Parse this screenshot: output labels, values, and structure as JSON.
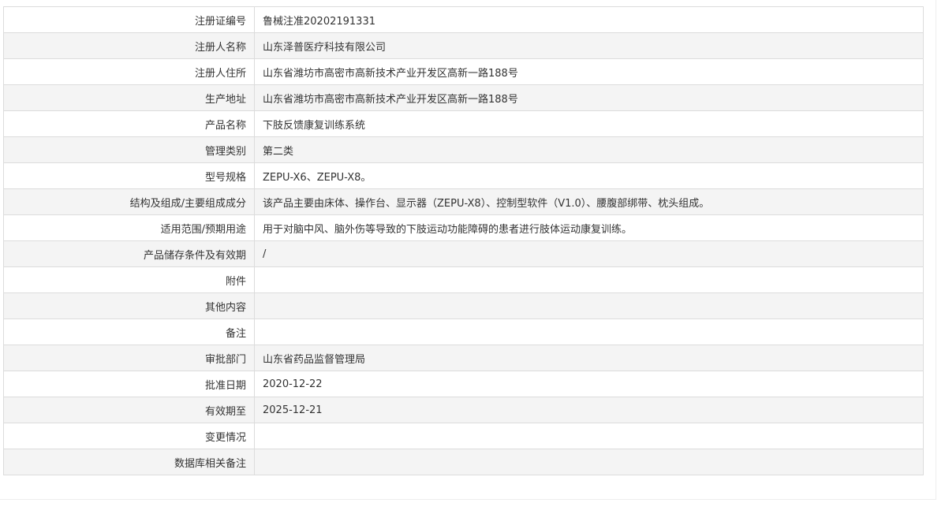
{
  "rows": [
    {
      "label": "注册证编号",
      "value": "鲁械注准20202191331"
    },
    {
      "label": "注册人名称",
      "value": "山东泽普医疗科技有限公司"
    },
    {
      "label": "注册人住所",
      "value": "山东省潍坊市高密市高新技术产业开发区高新一路188号"
    },
    {
      "label": "生产地址",
      "value": "山东省潍坊市高密市高新技术产业开发区高新一路188号"
    },
    {
      "label": "产品名称",
      "value": "下肢反馈康复训练系统"
    },
    {
      "label": "管理类别",
      "value": "第二类"
    },
    {
      "label": "型号规格",
      "value": "ZEPU-X6、ZEPU-X8。"
    },
    {
      "label": "结构及组成/主要组成成分",
      "value": "该产品主要由床体、操作台、显示器（ZEPU-X8）、控制型软件（V1.0）、腰腹部绑带、枕头组成。"
    },
    {
      "label": "适用范围/预期用途",
      "value": "用于对脑中风、脑外伤等导致的下肢运动功能障碍的患者进行肢体运动康复训练。"
    },
    {
      "label": "产品储存条件及有效期",
      "value": "/"
    },
    {
      "label": "附件",
      "value": ""
    },
    {
      "label": "其他内容",
      "value": ""
    },
    {
      "label": "备注",
      "value": ""
    },
    {
      "label": "审批部门",
      "value": "山东省药品监督管理局"
    },
    {
      "label": "批准日期",
      "value": "2020-12-22"
    },
    {
      "label": "有效期至",
      "value": "2025-12-21"
    },
    {
      "label": "变更情况",
      "value": ""
    },
    {
      "label": "数据库相关备注",
      "value": ""
    }
  ]
}
